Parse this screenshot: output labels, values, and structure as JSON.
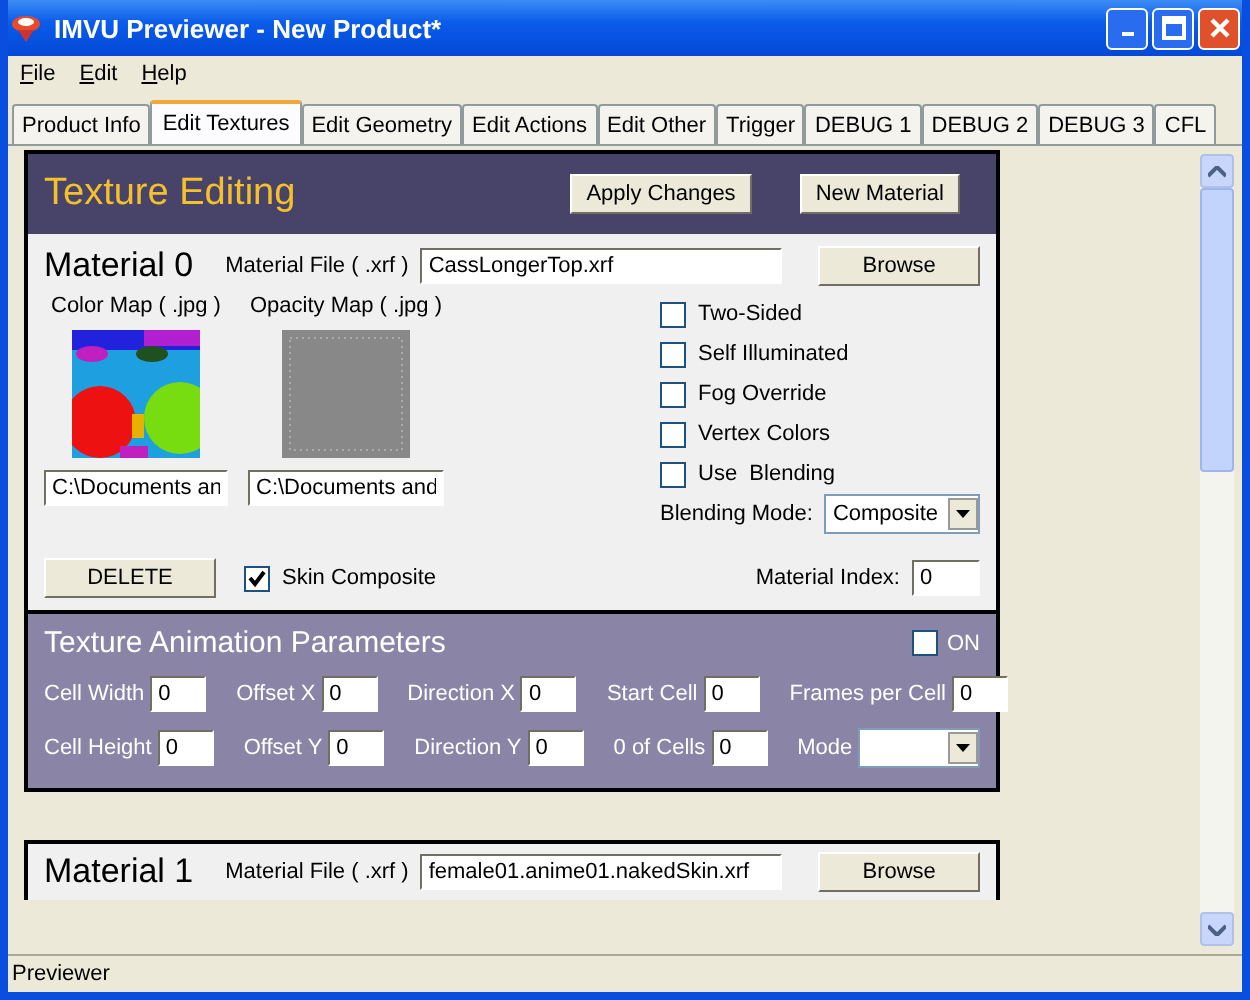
{
  "window": {
    "title": "IMVU Previewer - New Product*"
  },
  "menu": [
    {
      "label": "File"
    },
    {
      "label": "Edit"
    },
    {
      "label": "Help"
    }
  ],
  "tabs": [
    {
      "label": "Product Info",
      "selected": false
    },
    {
      "label": "Edit Textures",
      "selected": true
    },
    {
      "label": "Edit Geometry",
      "selected": false
    },
    {
      "label": "Edit Actions",
      "selected": false
    },
    {
      "label": "Edit Other",
      "selected": false
    },
    {
      "label": "Trigger",
      "selected": false
    },
    {
      "label": "DEBUG 1",
      "selected": false
    },
    {
      "label": "DEBUG 2",
      "selected": false
    },
    {
      "label": "DEBUG 3",
      "selected": false
    },
    {
      "label": "CFL",
      "selected": false
    }
  ],
  "header": {
    "title": "Texture Editing",
    "buttons": [
      "Apply Changes",
      "New Material"
    ]
  },
  "material": {
    "title": "Material 0",
    "file_label": "Material File ( .xrf )",
    "file": "CassLongerTop.xrf",
    "browse": "Browse",
    "color_map": {
      "label": "Color Map ( .jpg )",
      "path": "C:\\Documents an"
    },
    "opacity_map": {
      "label": "Opacity Map ( .jpg )",
      "path": "C:\\Documents and"
    },
    "options": [
      {
        "label": "Two-Sided",
        "checked": false
      },
      {
        "label": "Self Illuminated",
        "checked": false
      },
      {
        "label": "Fog Override",
        "checked": false
      },
      {
        "label": "Vertex Colors",
        "checked": false
      },
      {
        "label": "Use  Blending",
        "checked": false
      }
    ],
    "blending_label": "Blending Mode:",
    "blending": "Composite",
    "delete": "DELETE",
    "skin_composite": {
      "label": "Skin Composite",
      "checked": true
    },
    "index_label": "Material Index:",
    "index": "0"
  },
  "animation": {
    "title": "Texture Animation Parameters",
    "on": {
      "label": "ON",
      "checked": false
    },
    "rows": [
      [
        {
          "label": "Cell Width",
          "value": "0"
        },
        {
          "label": "Offset X",
          "value": "0"
        },
        {
          "label": "Direction X",
          "value": "0"
        },
        {
          "label": "Start Cell",
          "value": "0"
        },
        {
          "label": "Frames per Cell",
          "value": "0"
        }
      ],
      [
        {
          "label": "Cell Height",
          "value": "0"
        },
        {
          "label": "Offset Y",
          "value": "0"
        },
        {
          "label": "Direction Y",
          "value": "0"
        },
        {
          "label": "0 of Cells",
          "value": "0"
        }
      ]
    ],
    "mode_label": "Mode"
  },
  "next_material": {
    "title": "Material 1",
    "file_label": "Material File ( .xrf )",
    "file": "female01.anime01.nakedSkin.xrf",
    "browse": "Browse"
  },
  "status_bar": "Previewer"
}
